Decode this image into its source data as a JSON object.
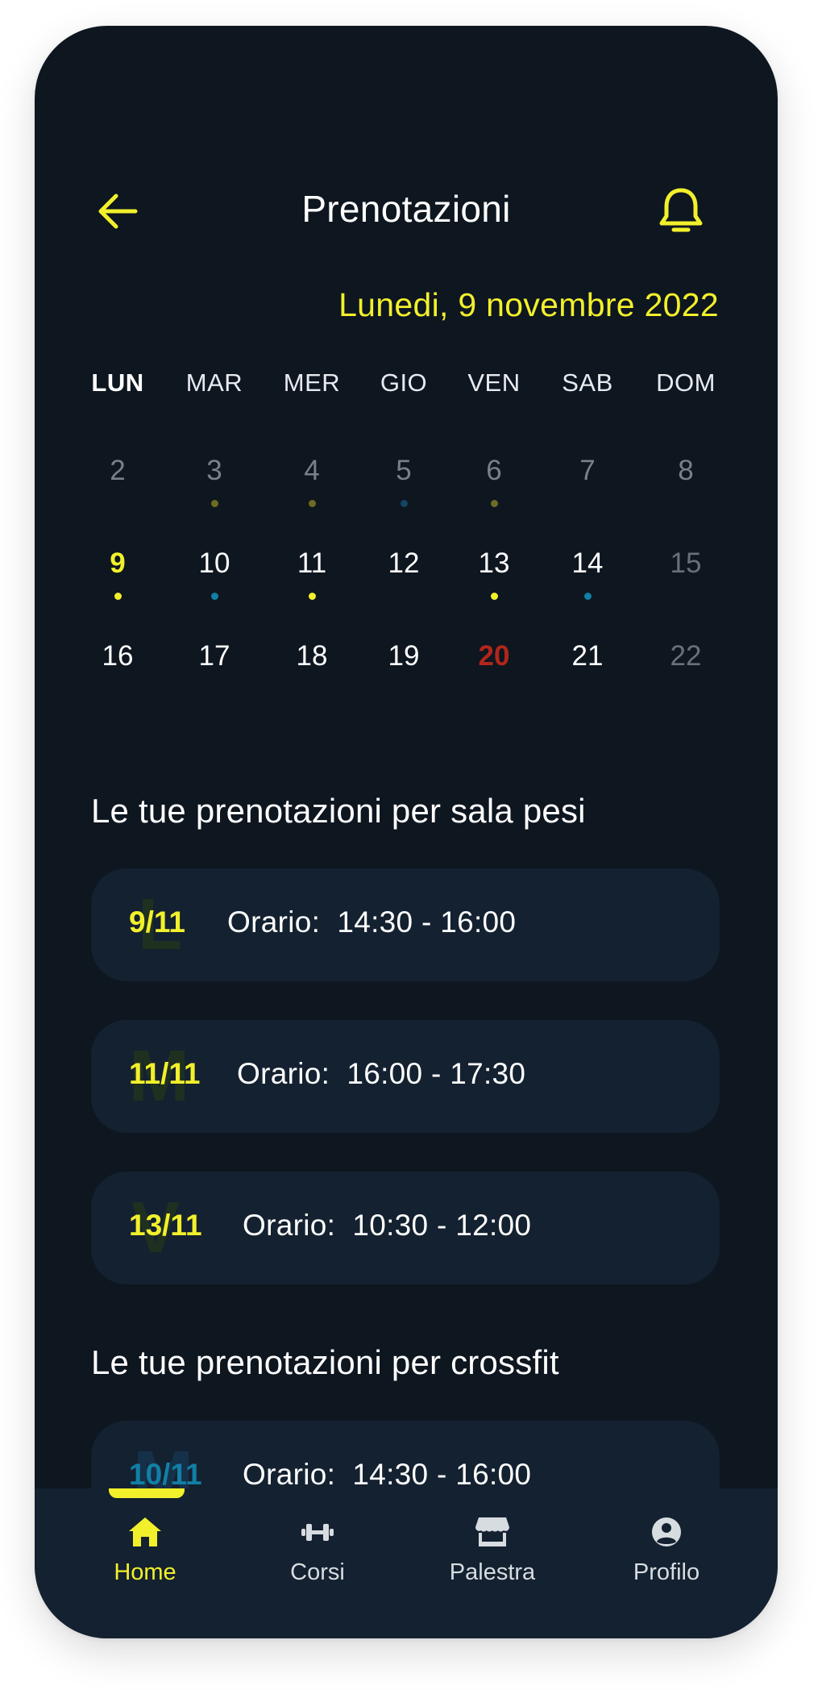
{
  "header": {
    "title": "Prenotazioni",
    "back_icon": "arrow-left-icon",
    "notification_icon": "bell-icon"
  },
  "calendar": {
    "current_date": "Lunedi, 9 novembre 2022",
    "weekdays": [
      "LUN",
      "MAR",
      "MER",
      "GIO",
      "VEN",
      "SAB",
      "DOM"
    ],
    "weeks": [
      [
        "2",
        "3",
        "4",
        "5",
        "6",
        "7",
        "8"
      ],
      [
        "9",
        "10",
        "11",
        "12",
        "13",
        "14",
        "15"
      ],
      [
        "16",
        "17",
        "18",
        "19",
        "20",
        "21",
        "22"
      ]
    ]
  },
  "sala_pesi": {
    "title": "Le tue prenotazioni per sala pesi",
    "bookings": [
      {
        "ghost": "L",
        "date": "9/11",
        "time": "Orario:  14:30 - 16:00"
      },
      {
        "ghost": "M",
        "date": "11/11",
        "time": "Orario:  16:00 - 17:30"
      },
      {
        "ghost": "V",
        "date": "13/11",
        "time": "Orario:  10:30 - 12:00"
      }
    ]
  },
  "crossfit": {
    "title": "Le tue prenotazioni per crossfit",
    "bookings": [
      {
        "ghost": "M",
        "date": "10/11",
        "time": "Orario:  14:30 - 16:00"
      }
    ]
  },
  "nav": {
    "items": [
      {
        "label": "Home",
        "icon": "home-icon"
      },
      {
        "label": "Corsi",
        "icon": "dumbbell-icon"
      },
      {
        "label": "Palestra",
        "icon": "store-icon"
      },
      {
        "label": "Profilo",
        "icon": "user-circle-icon"
      }
    ]
  },
  "colors": {
    "background": "#0e1620",
    "card": "#142130",
    "accent_yellow": "#f2f02b",
    "accent_blue": "#117fa6",
    "holiday_red": "#b1261a"
  }
}
